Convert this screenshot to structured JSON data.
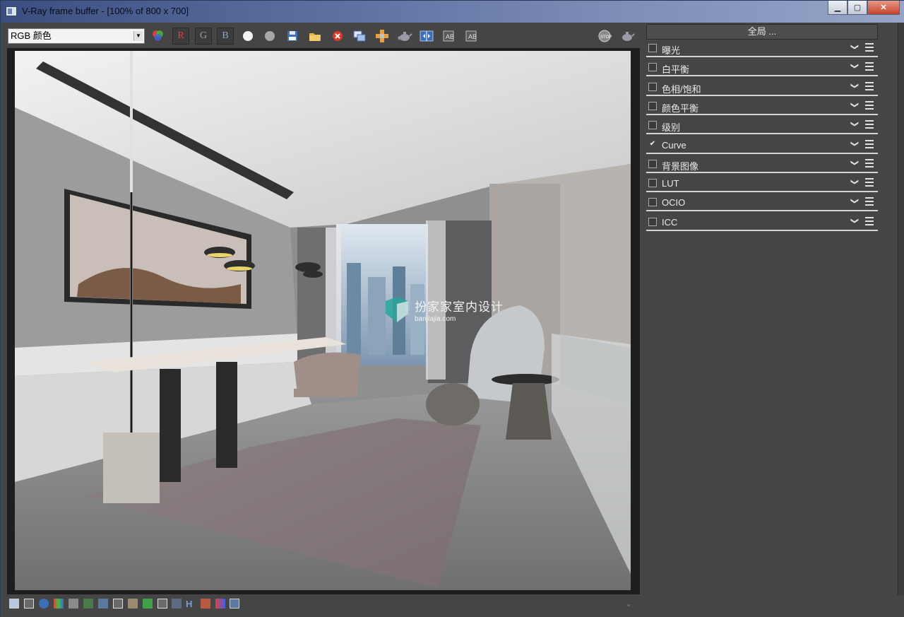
{
  "window": {
    "title": "V-Ray frame buffer - [100% of 800 x 700]",
    "minimize_label": "▁",
    "maximize_label": "▢",
    "close_label": "✕"
  },
  "toolbar": {
    "channel_value": "RGB 颜色",
    "r_label": "R",
    "g_label": "G",
    "b_label": "B"
  },
  "panel": {
    "header": "全局 ...",
    "layers": [
      {
        "label": "曝光",
        "checked": false
      },
      {
        "label": "白平衡",
        "checked": false
      },
      {
        "label": "色相/饱和",
        "checked": false
      },
      {
        "label": "颜色平衡",
        "checked": false
      },
      {
        "label": "级别",
        "checked": false
      },
      {
        "label": "Curve",
        "checked": true
      },
      {
        "label": "背景图像",
        "checked": false
      },
      {
        "label": "LUT",
        "checked": false
      },
      {
        "label": "OCIO",
        "checked": false
      },
      {
        "label": "ICC",
        "checked": false
      }
    ]
  },
  "render": {
    "watermark_title": "扮家家室内设计",
    "watermark_url": "banjiajia.com"
  },
  "colors": {
    "title_gradient_start": "#3a4f7f",
    "window_bg": "#454545",
    "panel_text": "#eaeaea",
    "close_red": "#c4432c"
  }
}
